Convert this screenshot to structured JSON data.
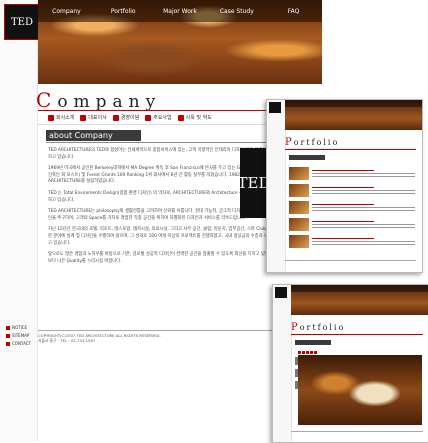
{
  "logo": {
    "text": "TED"
  },
  "nav": [
    "Company",
    "Portfolio",
    "Major Work",
    "Case Study",
    "FAQ"
  ],
  "page": {
    "title_cap": "C",
    "title_rest": "ompany"
  },
  "subnav": [
    "회사소개",
    "대표이사",
    "경영이념",
    "주요사업",
    "사옥 및 약도"
  ],
  "section": {
    "heading": "about Company"
  },
  "body": [
    "TED ARCHITECTURE의 TED와 합성어는 전세계적으로 종합서비스에 있는, 고객 지향적인 인테리어 디자인 전문 건축설계사무실을 운영하고 있습니다.",
    "1969년 미국에서 공인된 Berkeley대학에서 MA Degree 취득 후 San Francisco에 본사를 두고 있는 Gensler & Associate (미국 건축인 회 포스트) 및 Forest Grants 100 Ranking 1위 회사에서 6년 간 활동 실무를 익혔습니다. 1982년 서울 TED ARCHITECTURE를 설립하였습니다.",
    "TED 는 Total Enviroments Design(종합 환경 디자인) 의 약자로, ARCHITECTURE와 Architecture • Interior 디자인 및 컨설팅을 하고 있습니다.",
    "TED ARCHITECTURE는 philosophy와 생활전통을 고려하여 신뢰를 이룹니다. 현대 기능적, 궁극적 디자인과 FULL 서비스를 통한 디자인을 추구하며, 고객의 Space를 가치로 경험한 각종 공간을 위하여 차별화된 디자인과 서비스를 약속드립니다.",
    "지난 15년간 한국내의 호텔, 리조트, 레스토랑, 레저시설, 의료시설, 그리고 사무 공간, 클럽, 라운지, 업무공간, 스파 Club, 노래방 등 다양한 분야에 설계 및 디자인을 수행하여 왔으며, 그 성과로 100 여개 이상의 프로젝트를 진행하였고, 국내 정상급의 수준과 노하우를 보유하고 있습니다.",
    "앞으로도 많은 경험과 노하우를 바탕으로 기존, 글로벌 성공적 디자인이 완벽한 공간을 창출할 수 있도록 최선을 다하고 있으며 저희 고객이 보다 나은 Quality를 누리시길 바랍니다."
  ],
  "side_menu": [
    "NOTICE",
    "SITEMAP",
    "CONTACT"
  ],
  "footer": {
    "line1": "COPYRIGHT(C)2007 TED ARCHITECTURE ALL RIGHTS RESERVED.",
    "line2": "서울시 중구 · TEL : 02-733-1567"
  },
  "thumb1": {
    "title_cap": "P",
    "title_rest": "ortfolio"
  },
  "thumb2": {
    "title_cap": "P",
    "title_rest": "ortfolio"
  }
}
